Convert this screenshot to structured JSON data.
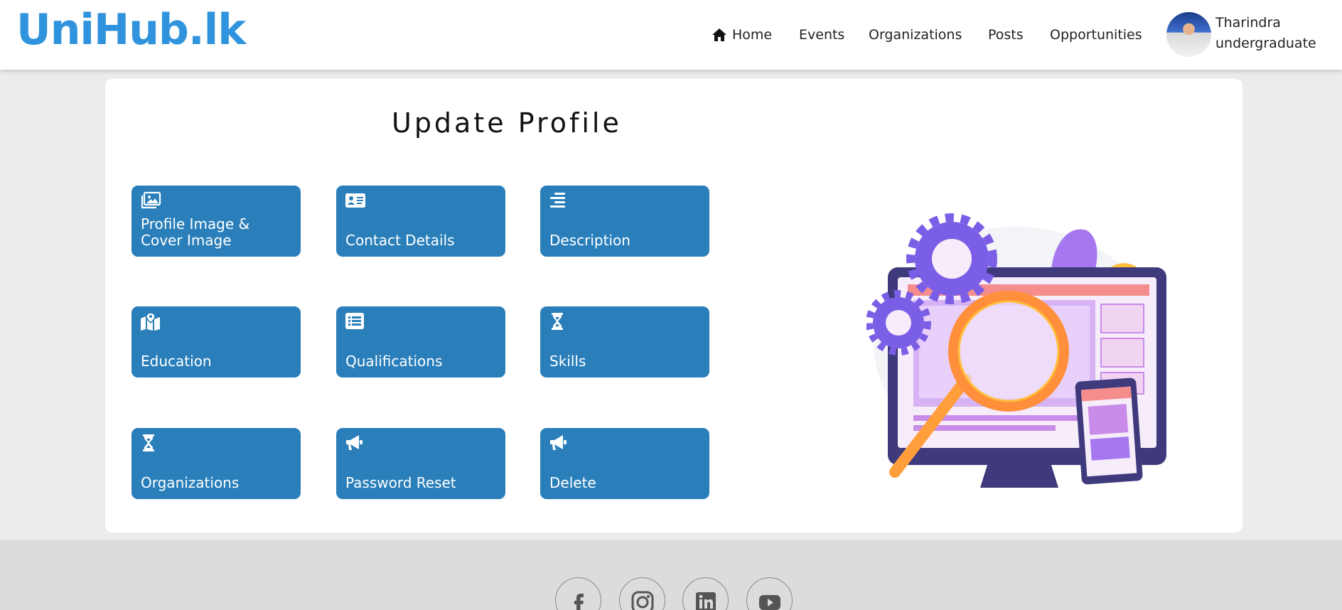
{
  "header": {
    "logo": "UniHub.lk",
    "nav": [
      {
        "label": "Home",
        "icon": "home-icon"
      },
      {
        "label": "Events"
      },
      {
        "label": "Organizations"
      },
      {
        "label": "Posts"
      },
      {
        "label": "Opportunities"
      }
    ],
    "user": {
      "name": "Tharindra",
      "role": "undergraduate"
    }
  },
  "main": {
    "title": "Update Profile",
    "tiles": [
      {
        "label": "Profile Image & Cover Image",
        "icon": "images-icon"
      },
      {
        "label": "Contact Details",
        "icon": "id-card-icon"
      },
      {
        "label": "Description",
        "icon": "align-right-icon"
      },
      {
        "label": "Education",
        "icon": "map-location-icon"
      },
      {
        "label": "Qualifications",
        "icon": "list-icon"
      },
      {
        "label": "Skills",
        "icon": "hourglass-icon"
      },
      {
        "label": "Organizations",
        "icon": "hourglass-icon"
      },
      {
        "label": "Password Reset",
        "icon": "bullhorn-icon"
      },
      {
        "label": "Delete",
        "icon": "bullhorn-icon"
      }
    ]
  },
  "footer": {
    "social": [
      "facebook-icon",
      "instagram-icon",
      "linkedin-icon",
      "youtube-icon"
    ]
  },
  "colors": {
    "brand": "#2f93dd",
    "tile": "#2a7fba",
    "page_bg": "#ececec",
    "footer_bg": "#dcdcdc"
  }
}
